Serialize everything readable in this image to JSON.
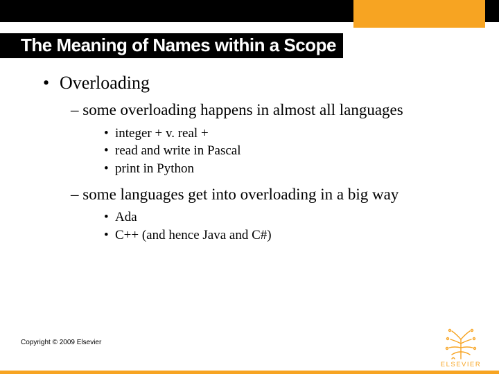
{
  "title": "The Meaning of Names within a Scope",
  "level1": [
    "Overloading"
  ],
  "level2": [
    "some overloading happens in almost all languages",
    "some languages get into overloading in a big way"
  ],
  "level3_group1": [
    "integer + v. real +",
    "read and write in Pascal",
    "print in Python"
  ],
  "level3_group2": [
    "Ada",
    "C++ (and hence Java and C#)"
  ],
  "copyright": "Copyright © 2009 Elsevier",
  "logo_text": "ELSEVIER",
  "colors": {
    "orange": "#f7a422",
    "black": "#000000"
  }
}
